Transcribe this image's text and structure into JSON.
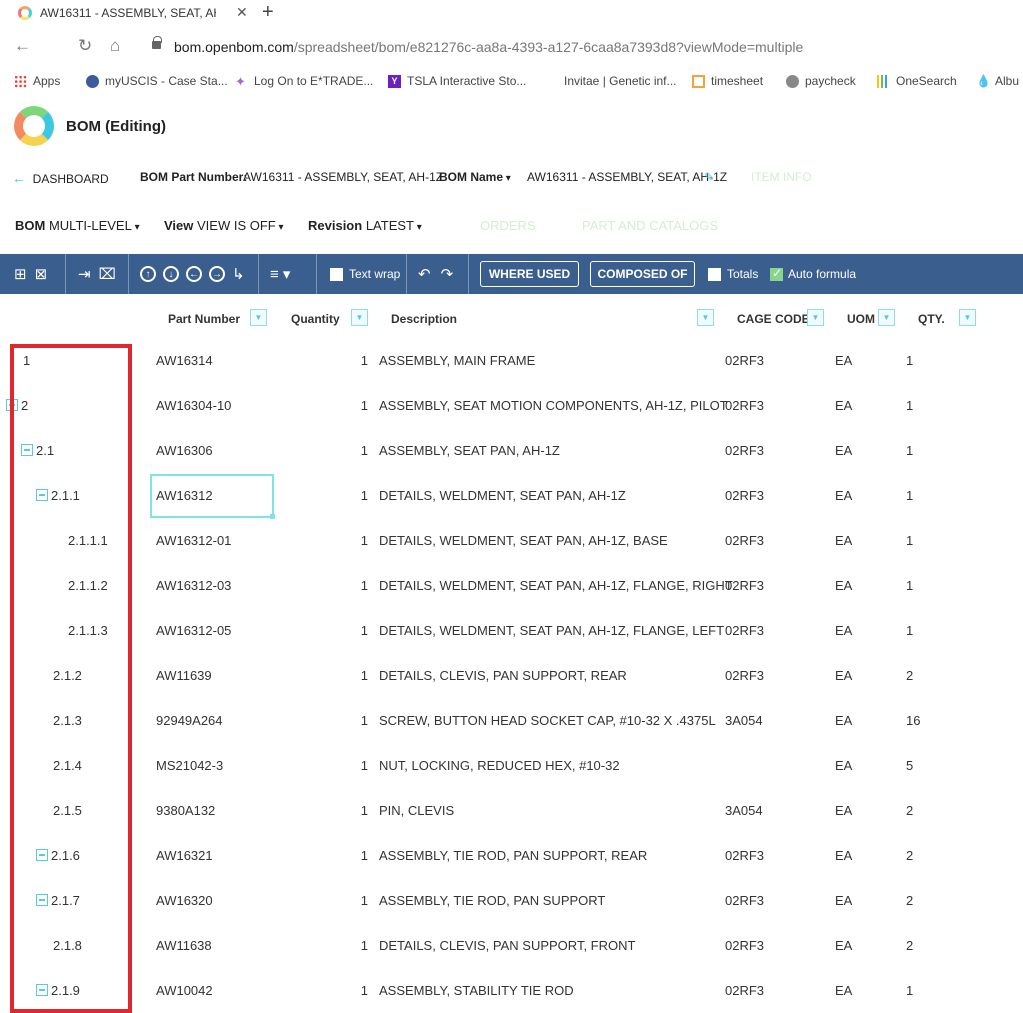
{
  "browser": {
    "tab_title": "AW16311 - ASSEMBLY, SEAT, AH-",
    "new_tab": "+",
    "close_tab": "✕",
    "url_domain": "bom.openbom.com",
    "url_path": "/spreadsheet/bom/e821276c-aa8a-4393-a127-6caa8a7393d8?viewMode=multiple",
    "bookmarks": [
      "Apps",
      "myUSCIS - Case Sta...",
      "Log On to E*TRADE...",
      "TSLA Interactive Sto...",
      "Invitae | Genetic inf...",
      "timesheet",
      "paycheck",
      "OneSearch",
      "Albu"
    ]
  },
  "app": {
    "title": "BOM (Editing)"
  },
  "info": {
    "dashboard": "DASHBOARD",
    "part_number_label": "BOM Part Number:",
    "part_number_value": "AW16311 - ASSEMBLY, SEAT, AH-1Z",
    "bom_name_label": "BOM Name",
    "bom_name_value": "AW16311 - ASSEMBLY, SEAT, AH-1Z",
    "item_info": "ITEM INFO"
  },
  "controls": {
    "bom_label": "BOM",
    "bom_value": "MULTI-LEVEL",
    "view_label": "View",
    "view_value": "VIEW IS OFF",
    "revision_label": "Revision",
    "revision_value": "LATEST",
    "orders": "ORDERS",
    "part_catalogs": "PART AND CATALOGS"
  },
  "toolbar": {
    "text_wrap": "Text wrap",
    "where_used": "WHERE USED",
    "composed_of": "COMPOSED OF",
    "totals": "Totals",
    "auto_formula": "Auto formula",
    "colors": {
      "bar": "#3a5f8e",
      "check_on": "#8bd48b"
    }
  },
  "table": {
    "headers": {
      "part_number": "Part Number",
      "quantity": "Quantity",
      "description": "Description",
      "cage_code": "CAGE CODE",
      "uom": "UOM",
      "qty": "QTY."
    },
    "rows": [
      {
        "level": "1",
        "part": "AW16314",
        "qty": "1",
        "desc": "ASSEMBLY, MAIN FRAME",
        "cage": "02RF3",
        "uom": "EA",
        "qty2": "1"
      },
      {
        "level": "2",
        "part": "AW16304-10",
        "qty": "1",
        "desc": "ASSEMBLY, SEAT MOTION COMPONENTS, AH-1Z, PILOT",
        "cage": "02RF3",
        "uom": "EA",
        "qty2": "1"
      },
      {
        "level": "2.1",
        "part": "AW16306",
        "qty": "1",
        "desc": "ASSEMBLY, SEAT PAN, AH-1Z",
        "cage": "02RF3",
        "uom": "EA",
        "qty2": "1"
      },
      {
        "level": "2.1.1",
        "part": "AW16312",
        "qty": "1",
        "desc": "DETAILS, WELDMENT, SEAT PAN, AH-1Z",
        "cage": "02RF3",
        "uom": "EA",
        "qty2": "1"
      },
      {
        "level": "2.1.1.1",
        "part": "AW16312-01",
        "qty": "1",
        "desc": "DETAILS, WELDMENT, SEAT PAN, AH-1Z, BASE",
        "cage": "02RF3",
        "uom": "EA",
        "qty2": "1"
      },
      {
        "level": "2.1.1.2",
        "part": "AW16312-03",
        "qty": "1",
        "desc": "DETAILS, WELDMENT, SEAT PAN, AH-1Z, FLANGE, RIGHT",
        "cage": "02RF3",
        "uom": "EA",
        "qty2": "1"
      },
      {
        "level": "2.1.1.3",
        "part": "AW16312-05",
        "qty": "1",
        "desc": "DETAILS, WELDMENT, SEAT PAN, AH-1Z, FLANGE, LEFT",
        "cage": "02RF3",
        "uom": "EA",
        "qty2": "1"
      },
      {
        "level": "2.1.2",
        "part": "AW11639",
        "qty": "1",
        "desc": "DETAILS, CLEVIS, PAN SUPPORT, REAR",
        "cage": "02RF3",
        "uom": "EA",
        "qty2": "2"
      },
      {
        "level": "2.1.3",
        "part": "92949A264",
        "qty": "1",
        "desc": "SCREW, BUTTON HEAD SOCKET CAP, #10-32 X .4375L",
        "cage": "3A054",
        "uom": "EA",
        "qty2": "16"
      },
      {
        "level": "2.1.4",
        "part": "MS21042-3",
        "qty": "1",
        "desc": "NUT, LOCKING, REDUCED HEX, #10-32",
        "cage": "",
        "uom": "EA",
        "qty2": "5"
      },
      {
        "level": "2.1.5",
        "part": "9380A132",
        "qty": "1",
        "desc": "PIN, CLEVIS",
        "cage": "3A054",
        "uom": "EA",
        "qty2": "2"
      },
      {
        "level": "2.1.6",
        "part": "AW16321",
        "qty": "1",
        "desc": "ASSEMBLY, TIE ROD, PAN SUPPORT, REAR",
        "cage": "02RF3",
        "uom": "EA",
        "qty2": "2"
      },
      {
        "level": "2.1.7",
        "part": "AW16320",
        "qty": "1",
        "desc": "ASSEMBLY, TIE ROD, PAN SUPPORT",
        "cage": "02RF3",
        "uom": "EA",
        "qty2": "2"
      },
      {
        "level": "2.1.8",
        "part": "AW11638",
        "qty": "1",
        "desc": "DETAILS, CLEVIS, PAN SUPPORT, FRONT",
        "cage": "02RF3",
        "uom": "EA",
        "qty2": "2"
      },
      {
        "level": "2.1.9",
        "part": "AW10042",
        "qty": "1",
        "desc": "ASSEMBLY, STABILITY TIE ROD",
        "cage": "02RF3",
        "uom": "EA",
        "qty2": "1"
      }
    ]
  },
  "colors": {
    "highlight": "#e0262e",
    "accent": "#5cc9dc"
  }
}
